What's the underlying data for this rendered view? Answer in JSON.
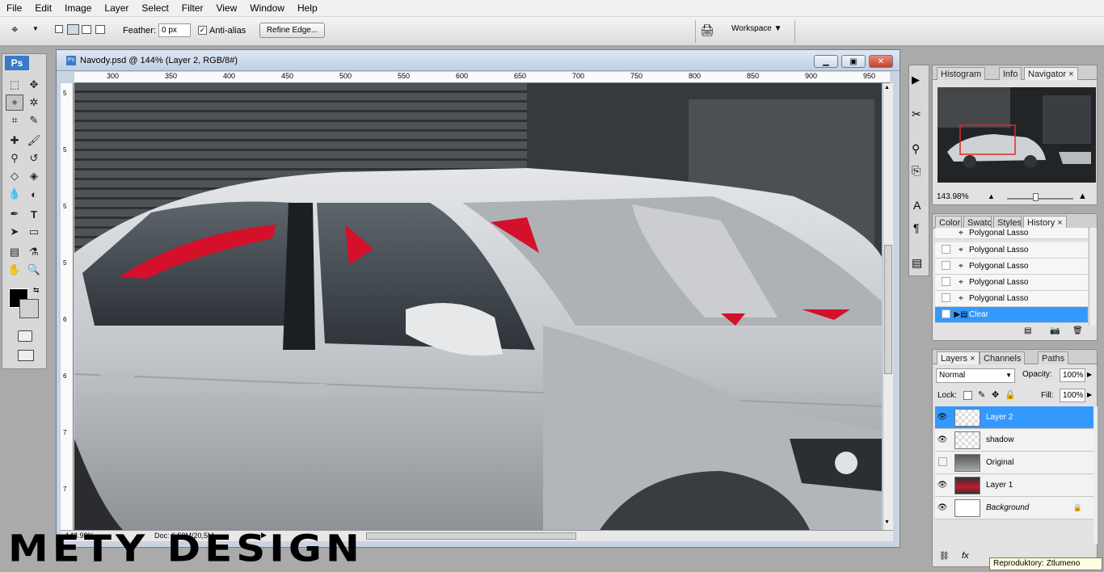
{
  "menu": [
    "File",
    "Edit",
    "Image",
    "Layer",
    "Select",
    "Filter",
    "View",
    "Window",
    "Help"
  ],
  "options": {
    "feather_label": "Feather:",
    "feather_value": "0 px",
    "antialias_label": "Anti-alias",
    "refine_edge": "Refine Edge...",
    "workspace": "Workspace"
  },
  "toolbox": {
    "logo": "Ps"
  },
  "document": {
    "title": "Navody.psd @ 144% (Layer 2, RGB/8#)",
    "ruler_h": [
      "300",
      "350",
      "400",
      "450",
      "500",
      "550",
      "600",
      "650",
      "700",
      "750",
      "800",
      "850",
      "900",
      "950"
    ],
    "ruler_v": [
      "5",
      "5",
      "5",
      "5",
      "6",
      "6",
      "6",
      "7",
      "7",
      "7",
      "7"
    ],
    "zoom": "143.98%",
    "doc_size": "Doc: 6,59M/20,5M"
  },
  "navigator": {
    "tabs": [
      "Histogram",
      "Info",
      "Navigator"
    ],
    "zoom": "143.98%"
  },
  "history": {
    "tabs": [
      "Color",
      "Swatc",
      "Styles",
      "History"
    ],
    "items": [
      "Polygonal Lasso",
      "Polygonal Lasso",
      "Polygonal Lasso",
      "Polygonal Lasso",
      "Polygonal Lasso",
      "Clear"
    ]
  },
  "layers": {
    "tabs": [
      "Layers",
      "Channels",
      "Paths"
    ],
    "blend_mode": "Normal",
    "opacity_label": "Opacity:",
    "opacity": "100%",
    "lock_label": "Lock:",
    "fill_label": "Fill:",
    "fill": "100%",
    "items": [
      {
        "name": "Layer 2",
        "visible": true
      },
      {
        "name": "shadow",
        "visible": true
      },
      {
        "name": "Original",
        "visible": false
      },
      {
        "name": "Layer 1",
        "visible": true
      },
      {
        "name": "Background",
        "visible": true
      }
    ]
  },
  "tooltip": "Reproduktory: Ztlumeno",
  "watermark": "METY DESIGN",
  "colors": {
    "accent": "#3399ff",
    "selection_red": "#d4102a"
  }
}
